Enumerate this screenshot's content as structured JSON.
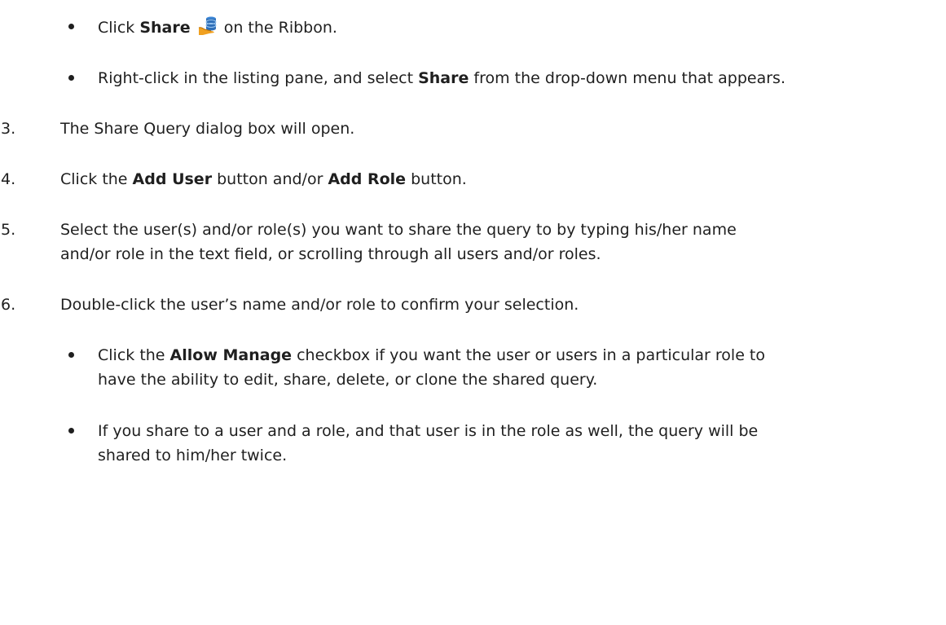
{
  "items": {
    "b1": {
      "pre": "Click ",
      "bold": "Share",
      "post": " on the Ribbon.",
      "icon": "database-share-icon"
    },
    "b2": {
      "pre": "Right-click in the listing pane, and select ",
      "bold": "Share",
      "post": " from the drop-down menu that appears."
    },
    "s3": {
      "number": "3.",
      "text": "The Share Query dialog box will open."
    },
    "s4": {
      "number": "4.",
      "pre": "Click the ",
      "bold1": "Add User",
      "mid": " button and/or ",
      "bold2": "Add Role",
      "post": " button."
    },
    "s5": {
      "number": "5.",
      "line1": "Select the user(s) and/or role(s) you want to share the query to by typing his/her name",
      "line2": "and/or role in the text field, or scrolling through all users and/or roles."
    },
    "s6": {
      "number": "6.",
      "text": "Double-click the user’s name and/or role to confirm your selection."
    },
    "b3": {
      "pre": "Click the ",
      "bold": "Allow Manage",
      "post1": " checkbox if you want the user or users in a particular role to",
      "line2": "have the ability to edit, share, delete, or clone the shared query."
    },
    "b4": {
      "line1": "If you share to a user and a role, and that user is in the role as well, the query will be",
      "line2": "shared to him/her twice."
    }
  },
  "colors": {
    "text": "#1f1f1f",
    "icon_db_blue": "#2f6fb8",
    "icon_hand_orange": "#f0a020"
  }
}
